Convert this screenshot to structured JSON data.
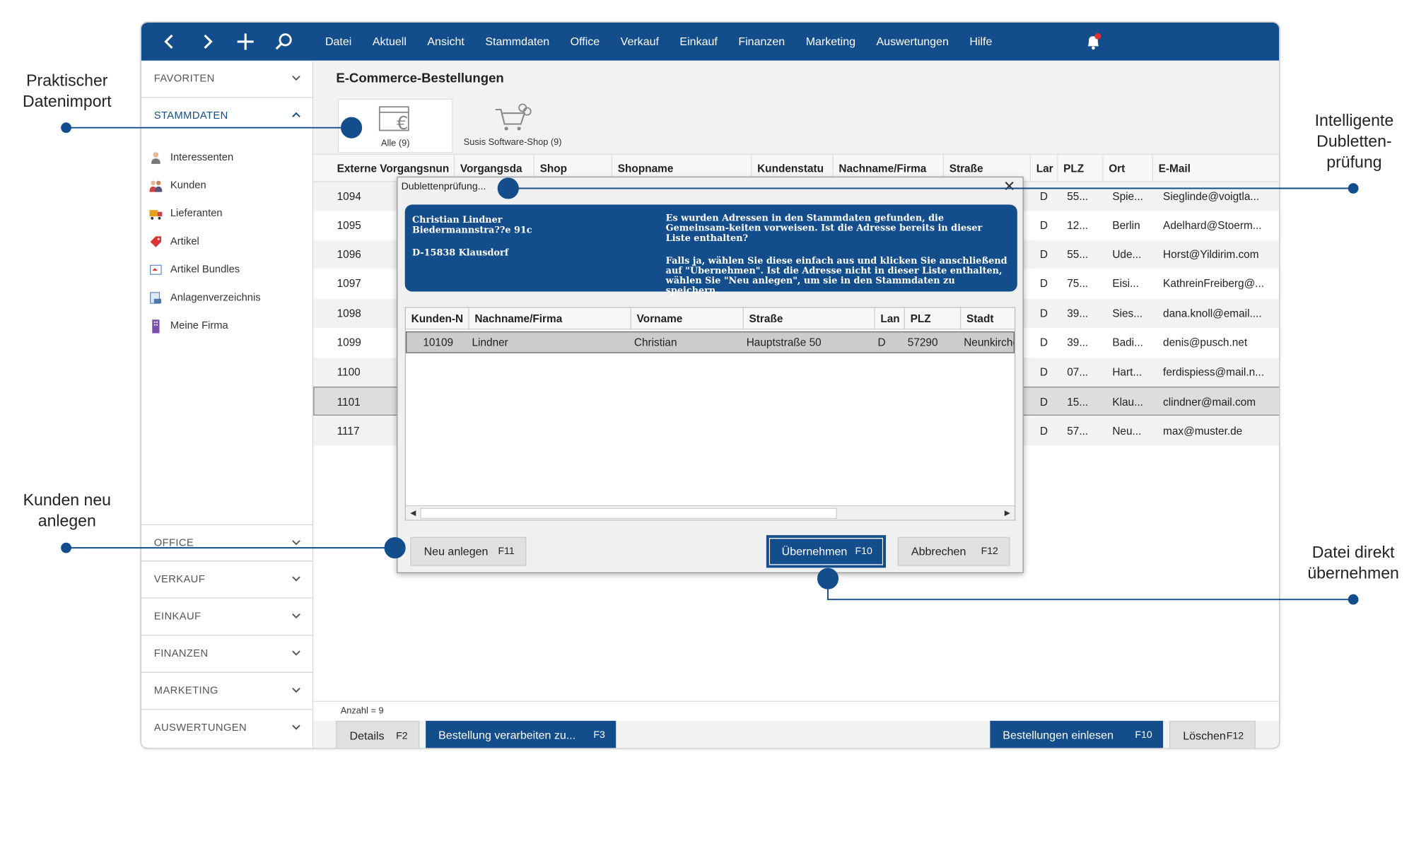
{
  "menu": [
    "Datei",
    "Aktuell",
    "Ansicht",
    "Stammdaten",
    "Office",
    "Verkauf",
    "Einkauf",
    "Finanzen",
    "Marketing",
    "Auswertungen",
    "Hilfe"
  ],
  "sidebar": {
    "favoriten": "FAVORITEN",
    "stammdaten": "STAMMDATEN",
    "items": [
      "Interessenten",
      "Kunden",
      "Lieferanten",
      "Artikel",
      "Artikel Bundles",
      "Anlagenverzeichnis",
      "Meine Firma"
    ],
    "groups": [
      "OFFICE",
      "VERKAUF",
      "EINKAUF",
      "FINANZEN",
      "MARKETING",
      "AUSWERTUNGEN"
    ]
  },
  "main": {
    "title": "E-Commerce-Bestellungen",
    "shops": [
      "Alle (9)",
      "Susis Software-Shop (9)"
    ],
    "columns": [
      "Externe Vorgangsnun",
      "Vorgangsda",
      "Shop",
      "Shopname",
      "Kundenstatu",
      "Nachname/Firma",
      "Straße",
      "Lar",
      "PLZ",
      "Ort",
      "E-Mail"
    ],
    "rows": [
      {
        "id": "1094",
        "land": "D",
        "plz": "55...",
        "ort": "Spie...",
        "email": "Sieglinde@voigtla..."
      },
      {
        "id": "1095",
        "land": "D",
        "plz": "12...",
        "ort": "Berlin",
        "email": "Adelhard@Stoerm..."
      },
      {
        "id": "1096",
        "land": "D",
        "plz": "55...",
        "ort": "Ude...",
        "email": "Horst@Yildirim.com"
      },
      {
        "id": "1097",
        "land": "D",
        "plz": "75...",
        "ort": "Eisi...",
        "email": "KathreinFreiberg@..."
      },
      {
        "id": "1098",
        "land": "D",
        "plz": "39...",
        "ort": "Sies...",
        "email": "dana.knoll@email...."
      },
      {
        "id": "1099",
        "land": "D",
        "plz": "39...",
        "ort": "Badi...",
        "email": "denis@pusch.net"
      },
      {
        "id": "1100",
        "land": "D",
        "plz": "07...",
        "ort": "Hart...",
        "email": "ferdispiess@mail.n..."
      },
      {
        "id": "1101",
        "land": "D",
        "plz": "15...",
        "ort": "Klau...",
        "email": "clindner@mail.com"
      },
      {
        "id": "1117",
        "land": "D",
        "plz": "57...",
        "ort": "Neu...",
        "email": "max@muster.de"
      }
    ],
    "count": "Anzahl = 9"
  },
  "bottom": {
    "details": "Details",
    "details_key": "F2",
    "process": "Bestellung verarbeiten zu...",
    "process_key": "F3",
    "import": "Bestellungen einlesen",
    "import_key": "F10",
    "delete": "Löschen",
    "delete_key": "F12"
  },
  "dialog": {
    "title": "Dublettenprüfung...",
    "addr1": "Christian Lindner",
    "addr2": "Biedermannstra??e 91c",
    "addr3": "D-15838 Klausdorf",
    "msg1": "Es wurden Adressen in den Stammdaten gefunden, die Gemeinsam-keiten vorweisen. Ist die Adresse bereits in dieser Liste enthalten?",
    "msg2": "Falls ja, wählen Sie diese einfach aus und klicken Sie anschließend auf \"Übernehmen\". Ist die Adresse nicht in dieser Liste enthalten, wählen Sie \"Neu anlegen\", um sie in den Stammdaten zu speichern.",
    "columns": [
      "Kunden-N",
      "Nachname/Firma",
      "Vorname",
      "Straße",
      "Lan",
      "PLZ",
      "Stadt"
    ],
    "row": [
      "10109",
      "Lindner",
      "Christian",
      "Hauptstraße 50",
      "D",
      "57290",
      "Neunkirchen"
    ],
    "new": "Neu anlegen",
    "new_key": "F11",
    "apply": "Übernehmen",
    "apply_key": "F10",
    "cancel": "Abbrechen",
    "cancel_key": "F12"
  },
  "callouts": {
    "import": "Praktischer Datenimport",
    "dup": "Intelligente Dubletten-prüfung",
    "new": "Kunden neu anlegen",
    "apply": "Datei direkt übernehmen"
  },
  "colors": {
    "brand": "#134d8c",
    "badge": "#e03030"
  }
}
